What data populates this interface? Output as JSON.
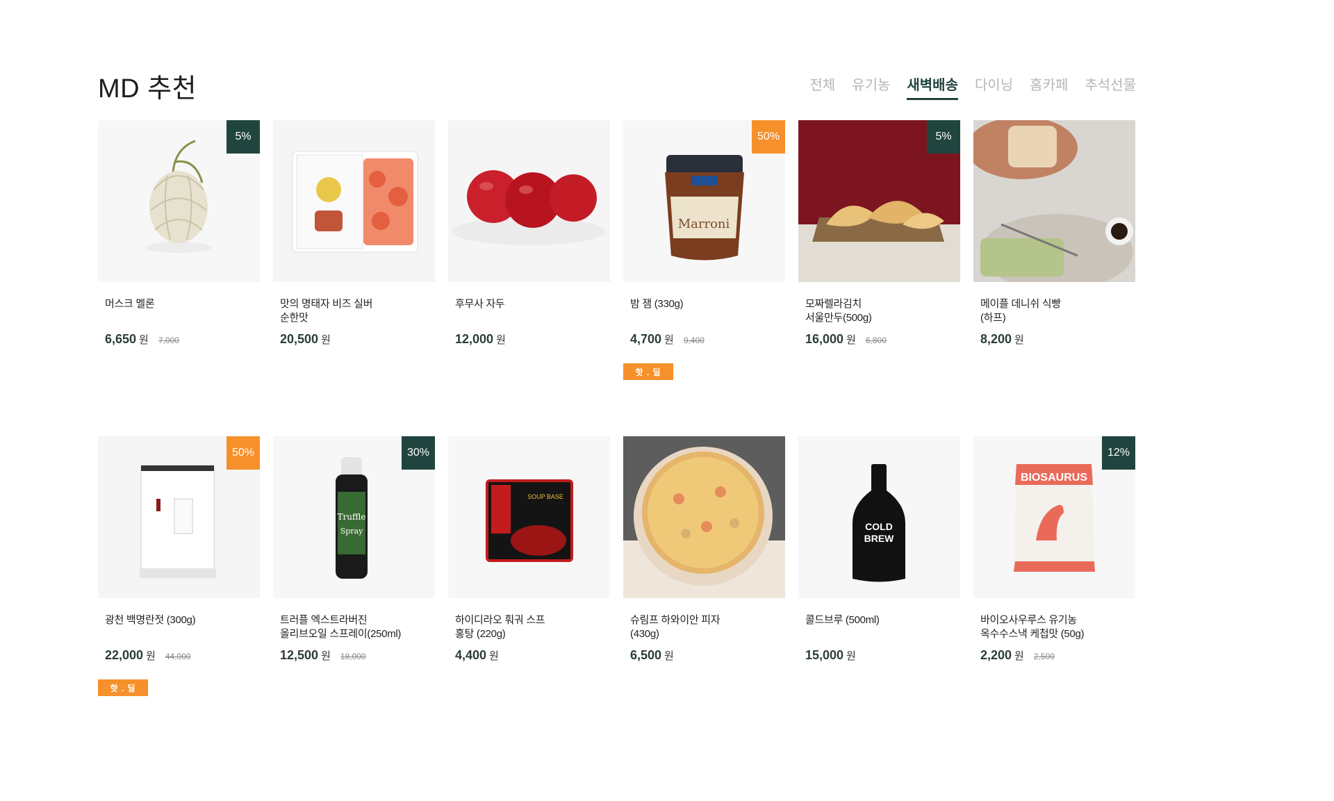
{
  "section": {
    "title": "MD 추천",
    "tabs": [
      "전체",
      "유기농",
      "새벽배송",
      "다이닝",
      "홈카페",
      "추석선물"
    ],
    "active_tab": "새벽배송"
  },
  "currency": "원",
  "hot_label": "핫 . 딜",
  "colors": {
    "accent_green": "#1f453e",
    "accent_orange": "#f6902a"
  },
  "products": [
    {
      "name": "머스크 멜론",
      "price": "6,650",
      "orig": "7,000",
      "discount": "5%",
      "badge_color": "green",
      "hot": false,
      "image": "melon"
    },
    {
      "name": "맛의 명태자 비즈 실버\n순한맛",
      "price": "20,500",
      "orig": "",
      "discount": "",
      "badge_color": "",
      "hot": false,
      "image": "roe"
    },
    {
      "name": "후무사 자두",
      "price": "12,000",
      "orig": "",
      "discount": "",
      "badge_color": "",
      "hot": false,
      "image": "plums"
    },
    {
      "name": "밤 잼 (330g)",
      "price": "4,700",
      "orig": "9,400",
      "discount": "50%",
      "badge_color": "orange",
      "hot": true,
      "image": "jam"
    },
    {
      "name": "모짜렐라김치\n서울만두(500g)",
      "price": "16,000",
      "orig": "6,800",
      "discount": "5%",
      "badge_color": "green",
      "hot": false,
      "image": "dumplings"
    },
    {
      "name": "메이플 데니쉬 식빵\n(하프)",
      "price": "8,200",
      "orig": "",
      "discount": "",
      "badge_color": "",
      "hot": false,
      "image": "bread"
    },
    {
      "name": "광천 백명란젓 (300g)",
      "price": "22,000",
      "orig": "44,000",
      "discount": "50%",
      "badge_color": "orange",
      "hot": true,
      "image": "box"
    },
    {
      "name": "트러플 엑스트라버진\n올리브오일 스프레이(250ml)",
      "price": "12,500",
      "orig": "18,000",
      "discount": "30%",
      "badge_color": "green",
      "hot": false,
      "image": "spray"
    },
    {
      "name": "하이디라오 훠궈 스프\n홍탕 (220g)",
      "price": "4,400",
      "orig": "",
      "discount": "",
      "badge_color": "",
      "hot": false,
      "image": "hotpot"
    },
    {
      "name": "슈림프 하와이안 피자\n(430g)",
      "price": "6,500",
      "orig": "",
      "discount": "",
      "badge_color": "",
      "hot": false,
      "image": "pizza"
    },
    {
      "name": "콜드브루 (500ml)",
      "price": "15,000",
      "orig": "",
      "discount": "",
      "badge_color": "",
      "hot": false,
      "image": "coldbrew"
    },
    {
      "name": "바이오사우루스 유기농\n옥수수스낵 케첩맛 (50g)",
      "price": "2,200",
      "orig": "2,500",
      "discount": "12%",
      "badge_color": "green",
      "hot": false,
      "image": "snack"
    }
  ]
}
